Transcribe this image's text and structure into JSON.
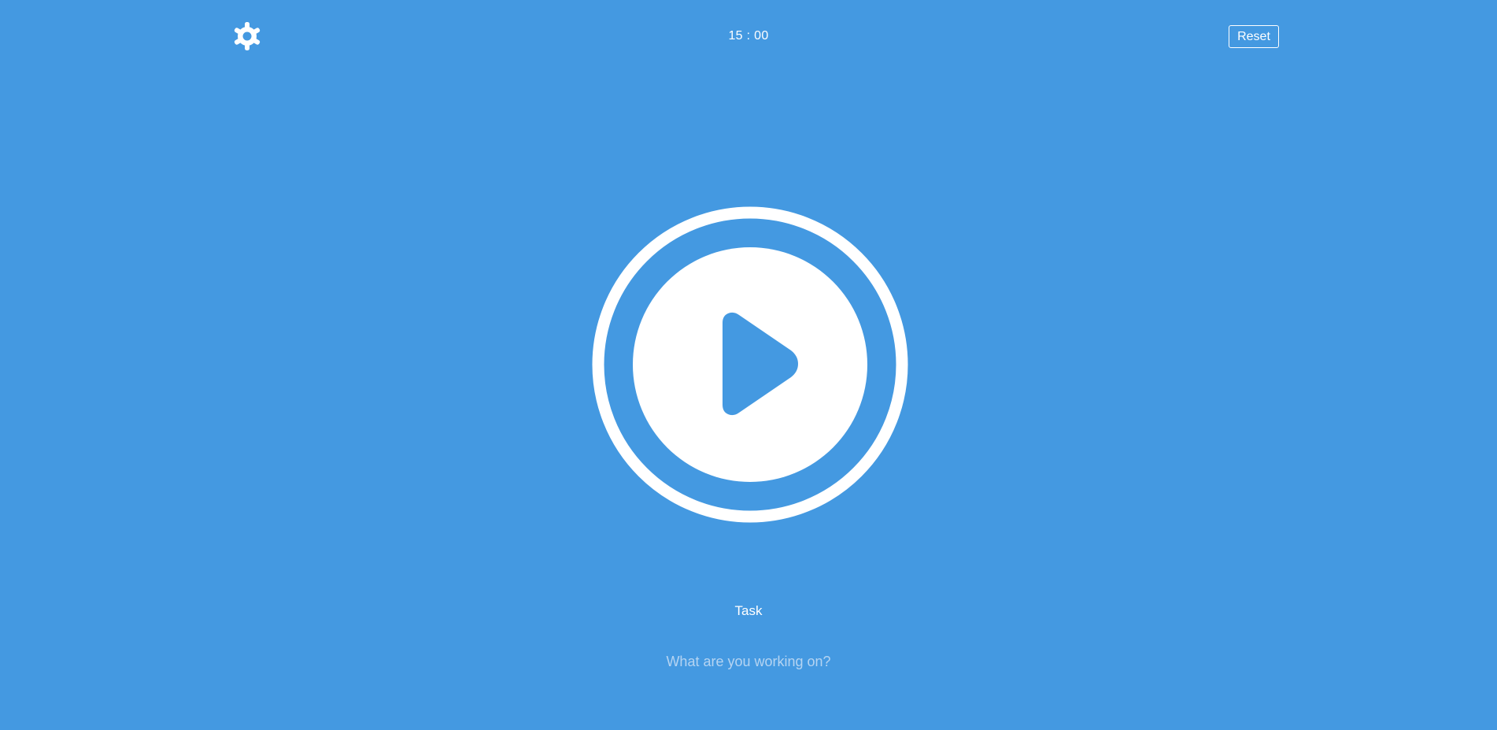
{
  "header": {
    "settings_icon": "gear-icon",
    "timer": "15 : 00",
    "reset_label": "Reset"
  },
  "player": {
    "play_icon": "play-icon",
    "state": "paused"
  },
  "task": {
    "label": "Task",
    "input_value": "",
    "input_placeholder": "What are you working on?"
  },
  "colors": {
    "background": "#4499e1",
    "foreground": "#ffffff",
    "placeholder": "#b5d4f2"
  }
}
